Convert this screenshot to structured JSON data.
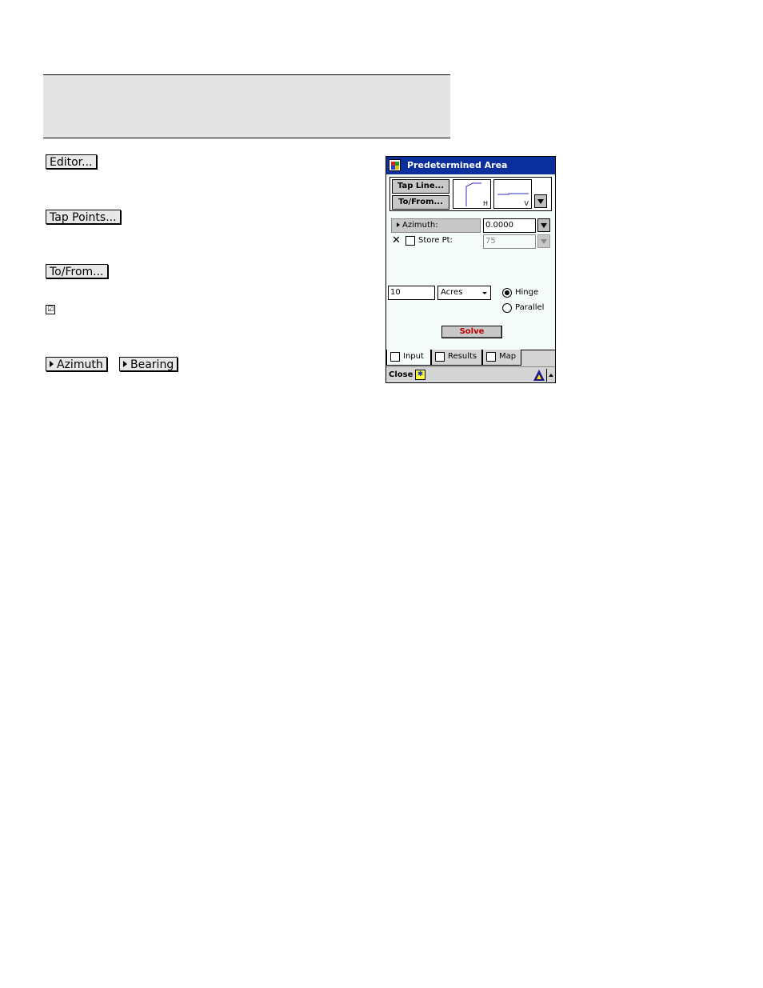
{
  "doc": {
    "header_text": "",
    "buttons": {
      "editor": "Editor...",
      "tap_points": "Tap Points...",
      "to_from": "To/From...",
      "azimuth": "Azimuth",
      "bearing": "Bearing"
    },
    "checkbox_glyph": "☑"
  },
  "device": {
    "title": "Predetermined Area",
    "tap_line": "Tap Line...",
    "to_from": "To/From...",
    "thumb_h": "H",
    "thumb_v": "V",
    "azimuth_label": "Azimuth:",
    "azimuth_value": "0.0000",
    "x_glyph": "✕",
    "store_pt_label": "Store Pt:",
    "store_pt_value": "75",
    "area_value": "10",
    "units": "Acres",
    "radio_options": [
      {
        "label": "Hinge",
        "selected": true
      },
      {
        "label": "Parallel",
        "selected": false
      }
    ],
    "solve": "Solve",
    "tabs": [
      {
        "label": "Input",
        "active": true
      },
      {
        "label": "Results",
        "active": false
      },
      {
        "label": "Map",
        "active": false
      }
    ],
    "close": "Close",
    "sip_glyph": "✱"
  },
  "colors": {
    "titlebar": "#0c2f9e",
    "solve_text": "#c00000",
    "thumb_line": "#2c2cc8"
  }
}
